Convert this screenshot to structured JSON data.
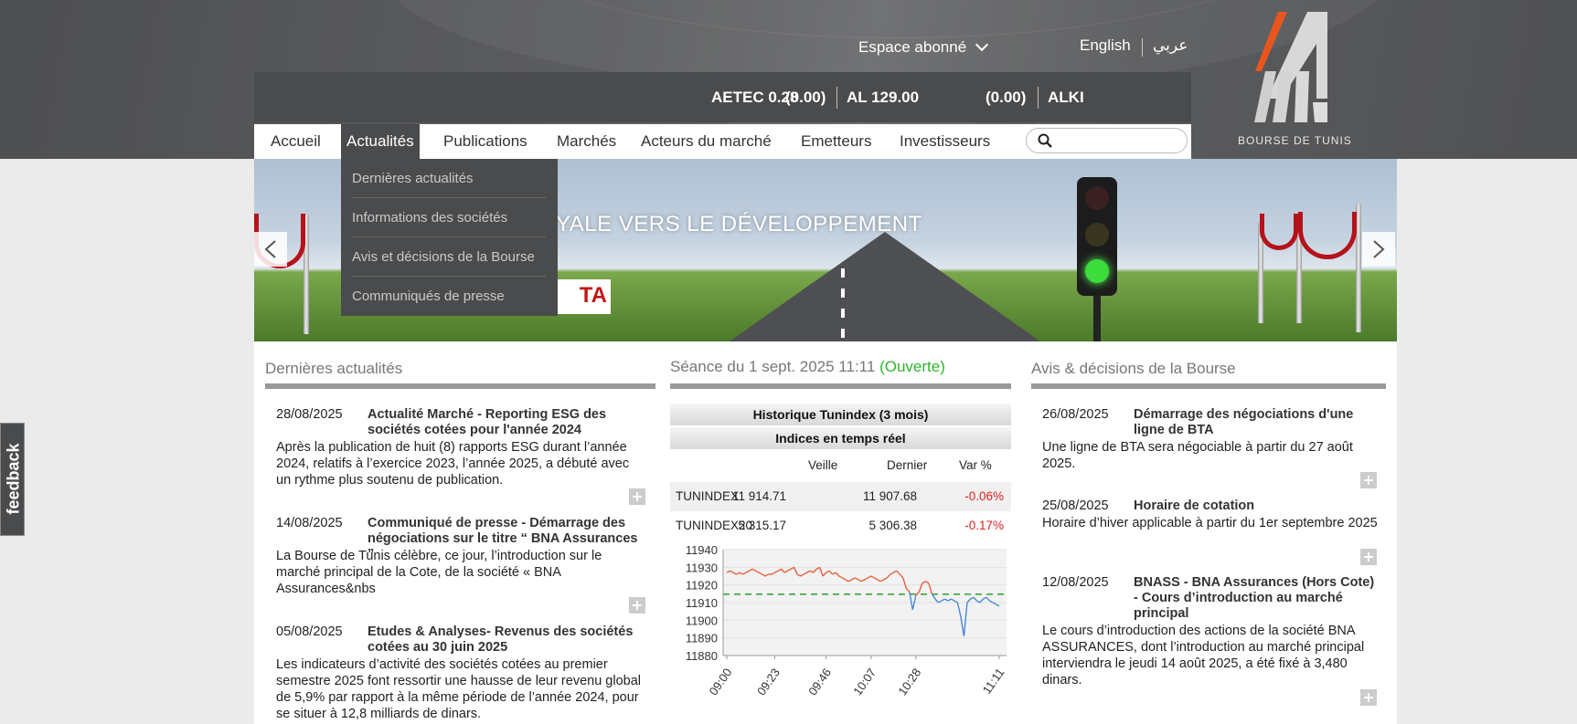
{
  "header": {
    "espace_abonne": "Espace abonné",
    "lang_en": "English",
    "lang_ar": "عربي",
    "logo_text": "BOURSE DE TUNIS"
  },
  "ticker": [
    {
      "text": "AETEC 0.28"
    },
    {
      "text": "(0.00)"
    },
    {
      "text": "AL 129.00"
    },
    {
      "text": "(0.00)"
    },
    {
      "text": "ALKI"
    }
  ],
  "nav": {
    "items": [
      "Accueil",
      "Actualités",
      "Publications",
      "Marchés",
      "Acteurs du marché",
      "Emetteurs",
      "Investisseurs"
    ],
    "active": "Actualités",
    "search_value": "",
    "search_placeholder": ""
  },
  "dropdown": [
    "Dernières actualités",
    "Informations des sociétés",
    "Avis et décisions de la Bourse",
    "Communiqués de presse"
  ],
  "banner": {
    "title": "YALE VERS LE DÉVELOPPEMENT",
    "logo": "TA"
  },
  "feedback": "feedback",
  "news": {
    "title": "Dernières actualités",
    "items": [
      {
        "date": "28/08/2025",
        "title": "Actualité Marché - Reporting ESG des sociétés cotées pour l'année 2024",
        "body": "Après la publication de huit (8) rapports ESG durant l’année 2024, relatifs à l’exercice 2023, l’année 2025, a débuté avec un rythme plus soutenu de publication."
      },
      {
        "date": "14/08/2025",
        "title": "Communiqué de presse - Démarrage des négociations sur le titre “ BNA Assurances ”",
        "body": "La Bourse de Tunis célèbre, ce jour, l’introduction sur le marché principal de la Cote, de la société « BNA Assurances&nbs"
      },
      {
        "date": "05/08/2025",
        "title": "Etudes & Analyses- Revenus des sociétés cotées au 30 juin 2025",
        "body": "Les indicateurs d’activité des sociétés cotées au premier semestre 2025 font ressortir une hausse de leur revenu global de 5,9% par rapport à la même période de l’année 2024, pour se situer à 12,8 milliards de dinars."
      }
    ]
  },
  "market": {
    "seance": "Séance du 1 sept. 2025 11:11",
    "status": "(Ouverte)",
    "historique_btn": "Historique Tunindex (3 mois)",
    "indices_btn": "Indices en temps réel",
    "columns": [
      "Veille",
      "Dernier",
      "Var %"
    ],
    "rows": [
      {
        "name": "TUNINDEX",
        "veille": "11 914.71",
        "dernier": "11 907.68",
        "var": "-0.06%"
      },
      {
        "name": "TUNINDEX20",
        "veille": "5 315.17",
        "dernier": "5 306.38",
        "var": "-0.17%"
      }
    ]
  },
  "chart_data": {
    "type": "line",
    "title": "",
    "xlabel": "",
    "ylabel": "",
    "x_ticks": [
      "09:00",
      "09:23",
      "09:46",
      "10:07",
      "10:28",
      "11:11"
    ],
    "y_ticks": [
      11940,
      11930,
      11920,
      11910,
      11900,
      11890,
      11880
    ],
    "ylim": [
      11880,
      11940
    ],
    "reference_line": 11914.71,
    "series": [
      {
        "values": [
          11927,
          11928,
          11927,
          11926,
          11927,
          11926,
          11927,
          11928,
          11929,
          11928,
          11927,
          11926,
          11925,
          11926,
          11926,
          11927,
          11928,
          11929,
          11927,
          11928,
          11929,
          11930,
          11926,
          11925,
          11926,
          11927,
          11928,
          11927,
          11929,
          11930,
          11925,
          11927,
          11928,
          11926,
          11927,
          11925,
          11924,
          11923,
          11922,
          11923,
          11924,
          11923,
          11922,
          11923,
          11924,
          11925,
          11924,
          11923,
          11922,
          11923,
          11924,
          11926,
          11927,
          11928,
          11926,
          11924,
          11918,
          11916,
          11906,
          11914,
          11916,
          11921,
          11922,
          11921,
          11915,
          11912,
          11910,
          11911,
          11912,
          11911,
          11912,
          11911,
          11910,
          11902,
          11891,
          11910,
          11912,
          11913,
          11911,
          11910,
          11912,
          11913,
          11911,
          11910,
          11909,
          11908
        ]
      }
    ]
  }
}
